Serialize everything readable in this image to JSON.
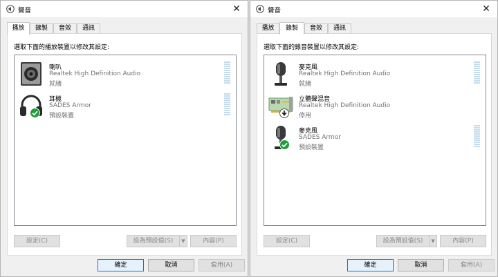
{
  "left_window": {
    "title": "聲音",
    "tabs": [
      {
        "label": "播放",
        "active": true
      },
      {
        "label": "錄製",
        "active": false
      },
      {
        "label": "音效",
        "active": false
      },
      {
        "label": "通訊",
        "active": false
      }
    ],
    "instruction": "選取下面的播放裝置以修改其設定:",
    "devices": [
      {
        "name": "喇叭",
        "driver": "Realtek High Definition Audio",
        "status": "就緒",
        "icon": "speaker-icon"
      },
      {
        "name": "耳機",
        "driver": "SADES Armor",
        "status": "預設裝置",
        "icon": "headphones-icon",
        "badge": "default-check-icon"
      }
    ],
    "buttons": {
      "configure": "設定(C)",
      "set_default": "設為預設值(S)",
      "properties": "內容(P)"
    },
    "footer": {
      "ok": "確定",
      "cancel": "取消",
      "apply": "套用(A)"
    }
  },
  "right_window": {
    "title": "聲音",
    "tabs": [
      {
        "label": "播放",
        "active": false
      },
      {
        "label": "錄製",
        "active": true
      },
      {
        "label": "音效",
        "active": false
      },
      {
        "label": "通訊",
        "active": false
      }
    ],
    "instruction": "選取下面的錄音裝置以修改其設定:",
    "devices": [
      {
        "name": "麥克風",
        "driver": "Realtek High Definition Audio",
        "status": "就緒",
        "icon": "microphone-icon"
      },
      {
        "name": "立體聲混音",
        "driver": "Realtek High Definition Audio",
        "status": "停用",
        "icon": "sound-card-icon",
        "badge": "disabled-arrow-icon"
      },
      {
        "name": "麥克風",
        "driver": "SADES Armor",
        "status": "預設裝置",
        "icon": "microphone-icon",
        "badge": "default-check-icon"
      }
    ],
    "buttons": {
      "configure": "設定(C)",
      "set_default": "設為預設值(S)",
      "properties": "內容(P)"
    },
    "footer": {
      "ok": "確定",
      "cancel": "取消",
      "apply": "套用(A)"
    }
  },
  "colors": {
    "accent": "#0078d7",
    "check_badge": "#1e9e3a",
    "meter": "#c4dcec"
  }
}
